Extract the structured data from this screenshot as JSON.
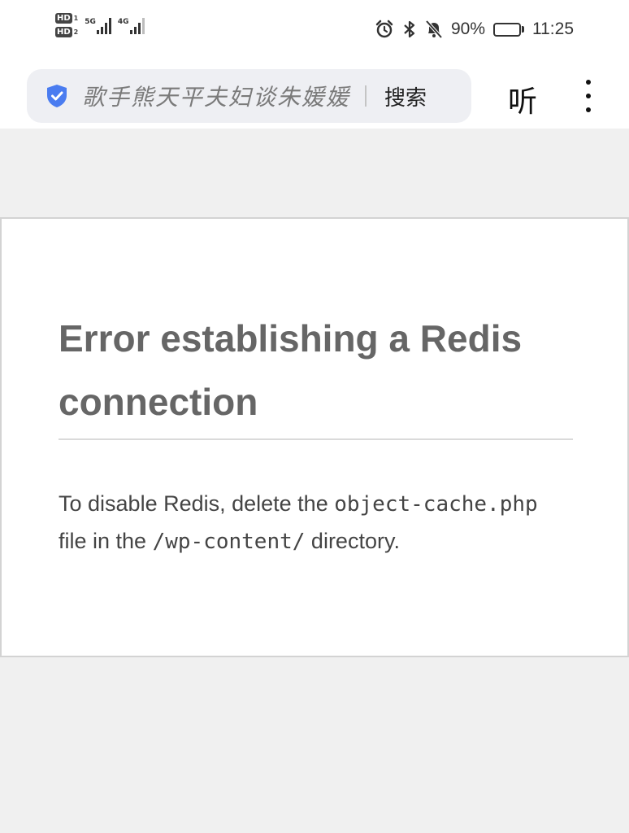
{
  "status_bar": {
    "sim1_badge": "HD",
    "sim1_index": "1",
    "sim2_badge": "HD",
    "sim2_index": "2",
    "network1": "5G",
    "network2": "4G",
    "battery_percent": "90%",
    "battery_level": 0.9,
    "time": "11:25",
    "icons": [
      "alarm-icon",
      "bluetooth-icon",
      "mute-icon",
      "battery-icon"
    ]
  },
  "search_bar": {
    "query": "歌手熊天平夫妇谈朱媛媛",
    "search_button_label": "搜索",
    "listen_label": "听",
    "shield_color": "#4a7cf0"
  },
  "page": {
    "title": "Error establishing a Redis connection",
    "message_part1": "To disable Redis, delete the ",
    "code_file": "object-cache.php",
    "message_part2": " file in the ",
    "code_dir": "/wp-content/",
    "message_part3": " directory."
  }
}
